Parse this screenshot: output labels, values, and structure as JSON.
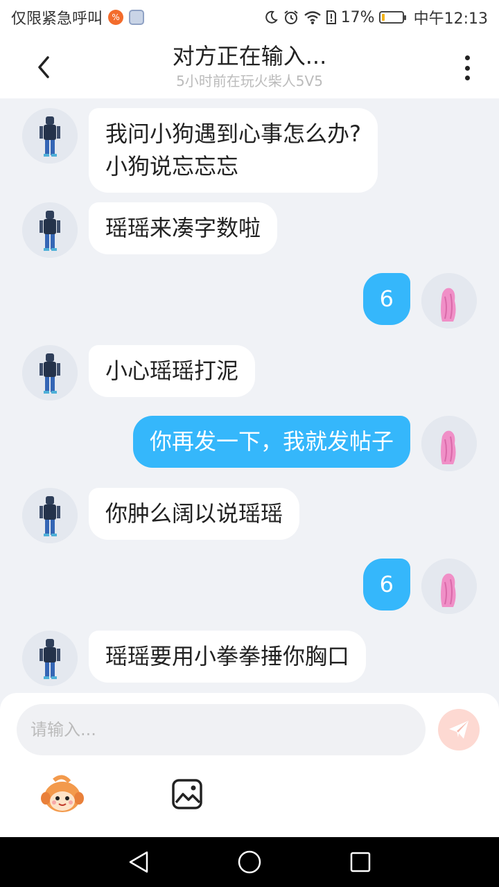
{
  "status_bar": {
    "carrier": "仅限紧急呼叫",
    "battery_percent": "17%",
    "time": "中午12:13",
    "battery_level": 0.17,
    "battery_color": "#f3b31a",
    "icons": [
      "app-icon",
      "moon-icon",
      "alarm-icon",
      "wifi-icon",
      "sim-alert-icon",
      "battery-icon"
    ]
  },
  "header": {
    "title": "对方正在输入...",
    "subtitle": "5小时前在玩火柴人5V5"
  },
  "messages": [
    {
      "side": "left",
      "text": "我问小狗遇到心事怎么办?\n小狗说忘忘忘"
    },
    {
      "side": "left",
      "text": "瑶瑶来凑字数啦"
    },
    {
      "side": "right",
      "text": "6"
    },
    {
      "side": "left",
      "text": "小心瑶瑶打泥"
    },
    {
      "side": "right",
      "text": "你再发一下，我就发帖子"
    },
    {
      "side": "left",
      "text": "你肿么阔以说瑶瑶"
    },
    {
      "side": "right",
      "text": "6"
    },
    {
      "side": "left",
      "text": "瑶瑶要用小拳拳捶你胸口"
    }
  ],
  "composer": {
    "placeholder": "请输入...",
    "value": ""
  },
  "colors": {
    "self_bubble": "#35b7fb",
    "other_bubble": "#ffffff",
    "background": "#f0f2f6",
    "send_button": "#fdd9d2"
  }
}
